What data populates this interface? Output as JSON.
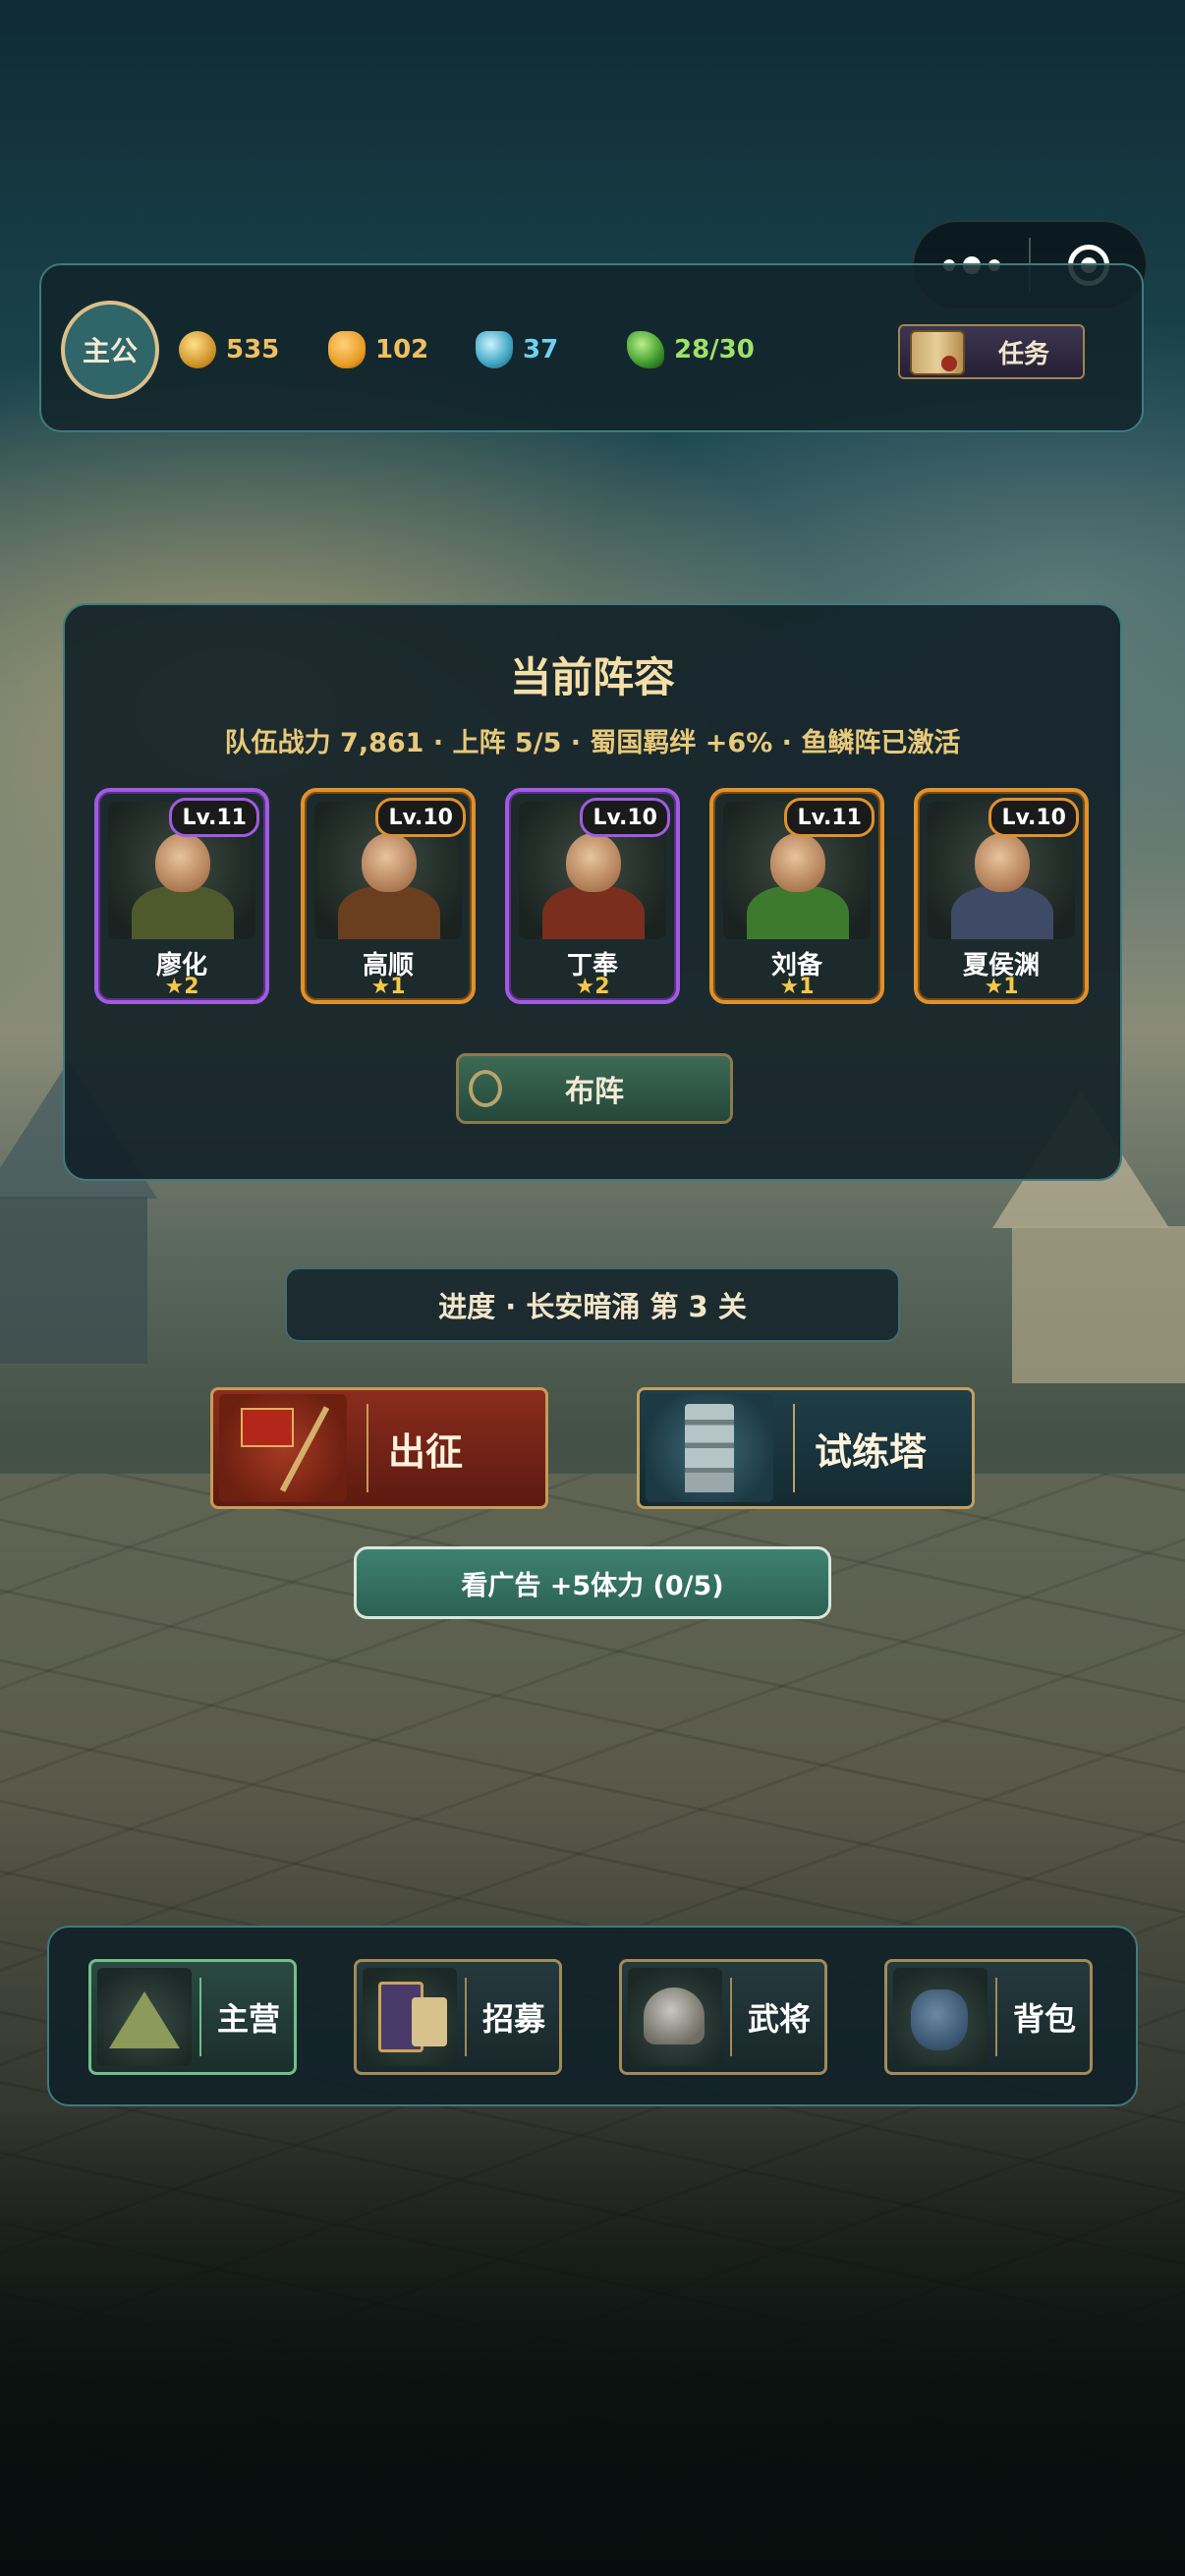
{
  "topbar": {
    "avatar_label": "主公",
    "resources": [
      {
        "icon": "coin-icon",
        "value": "535",
        "color": "#f0c060"
      },
      {
        "icon": "gold-ingot-icon",
        "value": "102",
        "color": "#f0c060"
      },
      {
        "icon": "jade-icon",
        "value": "37",
        "color": "#6fd0f0"
      },
      {
        "icon": "stamina-icon",
        "value": "28/30",
        "color": "#9fe06a"
      }
    ],
    "task_label": "任务"
  },
  "lineup": {
    "title": "当前阵容",
    "subtitle": "队伍战力 7,861 · 上阵 5/5 · 蜀国羁绊 +6% · 鱼鳞阵已激活",
    "heroes": [
      {
        "name": "廖化",
        "level": "Lv.11",
        "stars": "★2",
        "rarity": "purple",
        "armor": "#4f5a2c"
      },
      {
        "name": "高顺",
        "level": "Lv.10",
        "stars": "★1",
        "rarity": "orange",
        "armor": "#6a3e1e"
      },
      {
        "name": "丁奉",
        "level": "Lv.10",
        "stars": "★2",
        "rarity": "purple",
        "armor": "#7a2e1e"
      },
      {
        "name": "刘备",
        "level": "Lv.11",
        "stars": "★1",
        "rarity": "orange",
        "armor": "#3e7a2e"
      },
      {
        "name": "夏侯渊",
        "level": "Lv.10",
        "stars": "★1",
        "rarity": "orange",
        "armor": "#3e4a66"
      }
    ],
    "deploy_label": "布阵"
  },
  "progress_label": "进度 · 长安暗涌  第 3 关",
  "actions": {
    "expedition_label": "出征",
    "tower_label": "试练塔"
  },
  "ad_button_label": "看广告 +5体力 (0/5)",
  "bottom_nav": [
    {
      "label": "主营",
      "icon": "camp-tent-icon",
      "active": true
    },
    {
      "label": "招募",
      "icon": "recruit-card-icon",
      "active": false
    },
    {
      "label": "武将",
      "icon": "helmet-icon",
      "active": false
    },
    {
      "label": "背包",
      "icon": "bag-icon",
      "active": false
    }
  ]
}
